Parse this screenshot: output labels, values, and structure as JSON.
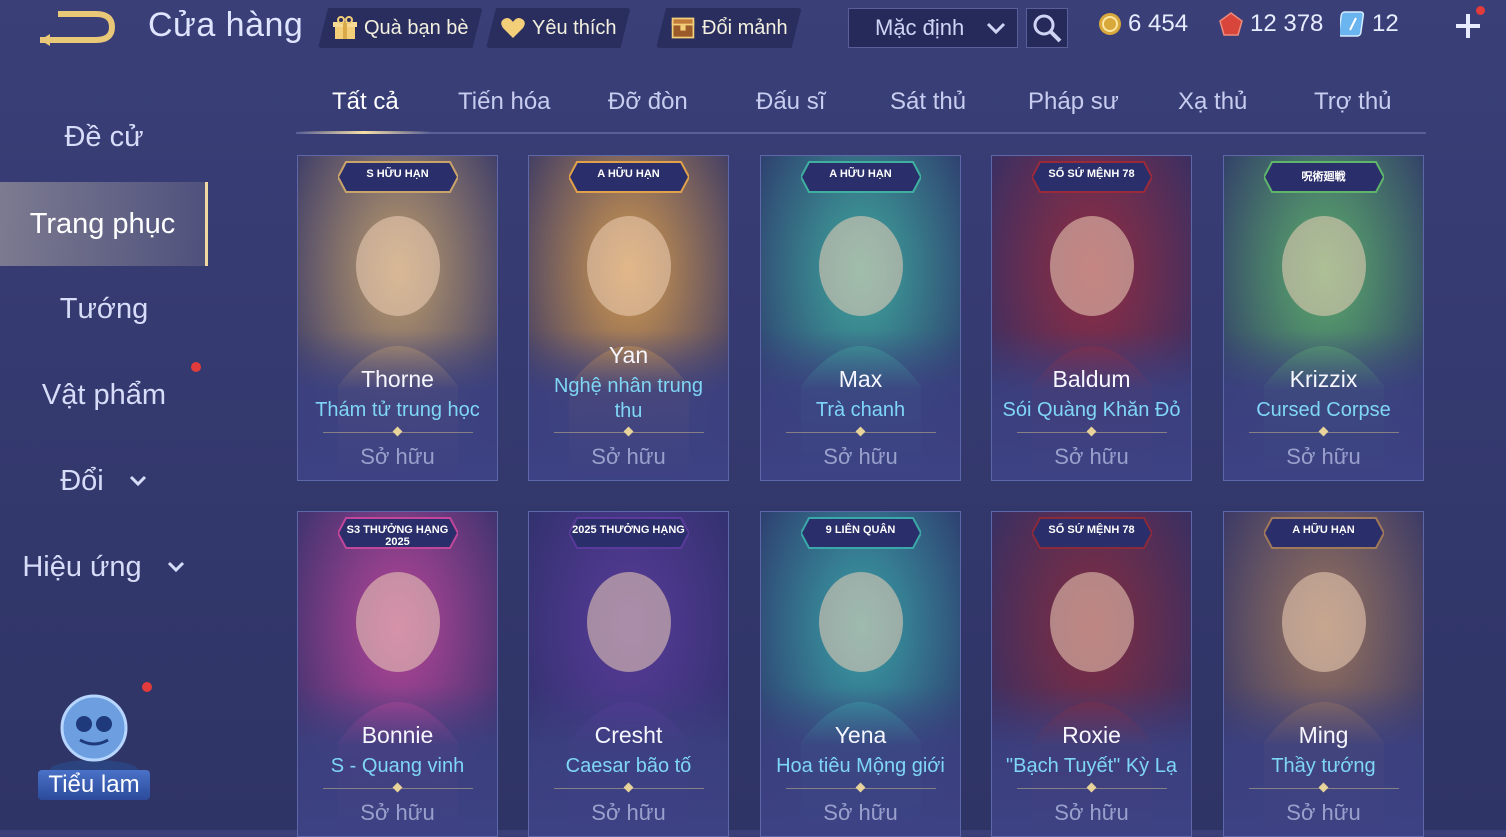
{
  "header": {
    "title": "Cửa hàng",
    "buttons": [
      {
        "label": "Quà bạn bè",
        "icon": "gift-icon"
      },
      {
        "label": "Yêu thích",
        "icon": "heart-icon"
      },
      {
        "label": "Đổi mảnh",
        "icon": "chest-icon"
      }
    ],
    "sort": {
      "value": "Mặc định"
    },
    "currencies": [
      {
        "icon": "gold-coin-icon",
        "value": "6 454"
      },
      {
        "icon": "ruby-icon",
        "value": "12 378"
      },
      {
        "icon": "voucher-icon",
        "value": "12"
      }
    ]
  },
  "sidebar": {
    "items": [
      {
        "label": "Đề cử"
      },
      {
        "label": "Trang phục",
        "active": true
      },
      {
        "label": "Tướng"
      },
      {
        "label": "Vật phẩm"
      },
      {
        "label": "Đổi"
      },
      {
        "label": "Hiệu ứng"
      }
    ],
    "bottom_label": "Tiểu lam"
  },
  "tabs": [
    "Tất cả",
    "Tiến hóa",
    "Đỡ đòn",
    "Đấu sĩ",
    "Sát thủ",
    "Pháp sư",
    "Xạ thủ",
    "Trợ thủ"
  ],
  "cards": [
    {
      "hero": "Thorne",
      "skin": "Thám tử trung học",
      "status": "Sở hữu",
      "badge": "S HỮU HẠN",
      "accent": "#c9a46a"
    },
    {
      "hero": "Yan",
      "skin": "Nghệ nhân trung thu",
      "status": "Sở hữu",
      "badge": "A HỮU HẠN",
      "accent": "#e0a14a"
    },
    {
      "hero": "Max",
      "skin": "Trà chanh",
      "status": "Sở hữu",
      "badge": "A HỮU HẠN",
      "accent": "#3fb0a0"
    },
    {
      "hero": "Baldum",
      "skin": "Sói Quàng Khăn Đỏ",
      "status": "Sở hữu",
      "badge": "SỐ SỨ MỆNH 78",
      "accent": "#9a2a3a"
    },
    {
      "hero": "Krizzix",
      "skin": "Cursed Corpse",
      "status": "Sở hữu",
      "badge": "呪術廻戦",
      "accent": "#5fb66a"
    },
    {
      "hero": "Bonnie",
      "skin": "S - Quang vinh",
      "status": "Sở hữu",
      "badge": "S3 THƯỞNG HẠNG 2025",
      "accent": "#c2469a"
    },
    {
      "hero": "Cresht",
      "skin": "Caesar bão tố",
      "status": "Sở hữu",
      "badge": "2025 THƯỞNG HẠNG",
      "accent": "#5a3a9a"
    },
    {
      "hero": "Yena",
      "skin": "Hoa tiêu Mộng giới",
      "status": "Sở hữu",
      "badge": "9 LIÊN QUÂN",
      "accent": "#3aa8a8"
    },
    {
      "hero": "Roxie",
      "skin": "\"Bạch Tuyết\" Kỳ Lạ",
      "status": "Sở hữu",
      "badge": "SỐ SỨ MỆNH 78",
      "accent": "#8a2a3a"
    },
    {
      "hero": "Ming",
      "skin": "Thầy tướng",
      "status": "Sở hữu",
      "badge": "A HỮU HẠN",
      "accent": "#a0785a"
    }
  ],
  "colors": {
    "gold": "#f0d9a0",
    "skin_text": "#7fd6f5",
    "red_dot": "#e23b3b"
  }
}
